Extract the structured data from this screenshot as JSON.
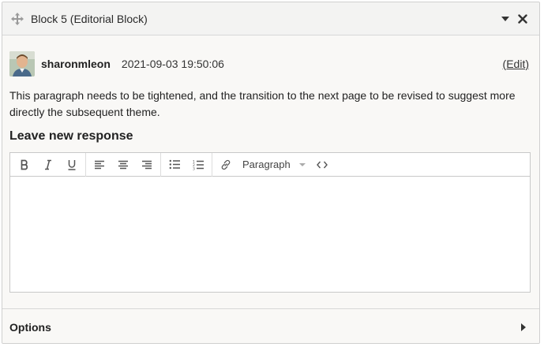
{
  "panel": {
    "title": "Block 5 (Editorial Block)",
    "icons": {
      "move": "move-arrows-icon",
      "collapse": "caret-down-icon",
      "close": "close-icon"
    }
  },
  "comment": {
    "username": "sharonmleon",
    "timestamp": "2021-09-03 19:50:06",
    "edit_label": "(Edit)",
    "body": "This paragraph needs to be tightened, and the transition to the next page to be revised to suggest more directly the subsequent theme."
  },
  "response": {
    "title": "Leave new response",
    "toolbar": {
      "format_value": "Paragraph",
      "buttons": [
        "bold",
        "italic",
        "underline",
        "align-left",
        "align-center",
        "align-right",
        "bullet-list",
        "numbered-list",
        "link",
        "source-code"
      ]
    },
    "content": ""
  },
  "options": {
    "label": "Options"
  },
  "colors": {
    "header_bg": "#f3f3f2",
    "panel_bg": "#f9f8f6",
    "border": "#cfcfcf",
    "icon": "#555555"
  }
}
